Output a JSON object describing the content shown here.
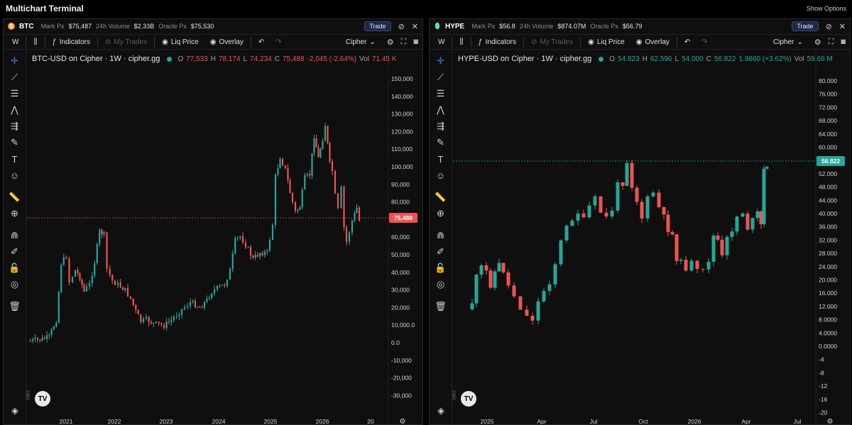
{
  "app": {
    "title": "Multichart Terminal",
    "show_options": "Show Options"
  },
  "left": {
    "symbol": "BTC",
    "info": {
      "mark_label": "Mark Px",
      "mark": "$75,487",
      "vol_label": "24h Volume",
      "vol": "$2.33B",
      "oracle_label": "Oracle Px",
      "oracle": "$75,530"
    },
    "trade": "Trade",
    "toolbar": {
      "interval": "W",
      "indicators": "Indicators",
      "my_trades": "My Trades",
      "liq_price": "Liq Price",
      "overlay": "Overlay",
      "source": "Cipher"
    },
    "legend": {
      "title": "BTC-USD on Cipher · 1W · cipher.gg",
      "o_k": "O",
      "o": "77,533",
      "h_k": "H",
      "h": "78,174",
      "l_k": "L",
      "l": "74,234",
      "c_k": "C",
      "c": "75,488",
      "chg": "-2,045 (-2.64%)",
      "vol_k": "Vol",
      "vol": "71.45 K"
    },
    "price_label": "75,488",
    "y_ticks": [
      "150,000",
      "140,000",
      "130,000",
      "120,000",
      "110,000",
      "100,000",
      "90,000",
      "80,000",
      "70,000",
      "60,000",
      "50,000",
      "40,000",
      "30,000",
      "20,000",
      "10,000.0",
      "0.0",
      "-10,000",
      "-20,000",
      "-30,000"
    ],
    "x_ticks": [
      "2021",
      "2022",
      "2023",
      "2024",
      "2025",
      "2026",
      "20"
    ],
    "colors": {
      "up": "#26a69a",
      "down": "#ef5350",
      "label": "#ef5350"
    }
  },
  "right": {
    "symbol": "HYPE",
    "info": {
      "mark_label": "Mark Px",
      "mark": "$56.8",
      "vol_label": "24h Volume",
      "vol": "$874.07M",
      "oracle_label": "Oracle Px",
      "oracle": "$56.79"
    },
    "trade": "Trade",
    "toolbar": {
      "interval": "W",
      "indicators": "Indicators",
      "my_trades": "My Trades",
      "liq_price": "Liq Price",
      "overlay": "Overlay",
      "source": "Cipher"
    },
    "legend": {
      "title": "HYPE-USD on Cipher · 1W · cipher.gg",
      "o_k": "O",
      "o": "54.823",
      "h_k": "H",
      "h": "62.596",
      "l_k": "L",
      "l": "54.000",
      "c_k": "C",
      "c": "56.822",
      "chg": "1.9860 (+3.62%)",
      "vol_k": "Vol",
      "vol": "59.66 M"
    },
    "price_label": "56.822",
    "y_ticks": [
      "80.000",
      "76.000",
      "72.000",
      "68.000",
      "64.000",
      "60.000",
      "56.000",
      "52.000",
      "48.000",
      "44.000",
      "40.000",
      "36.000",
      "32.000",
      "28.000",
      "24.000",
      "20.000",
      "16.000",
      "12.000",
      "8.0000",
      "4.0000",
      "0.0000",
      "-4",
      "-8",
      "-12",
      "-16",
      "-20"
    ],
    "x_ticks": [
      "2025",
      "Apr",
      "Jul",
      "Oct",
      "2026",
      "Apr",
      "Jul"
    ],
    "colors": {
      "up": "#26a69a",
      "down": "#ef5350",
      "label": "#26a69a"
    }
  },
  "icons": {
    "tools": [
      "crosshair-icon",
      "trend-line-icon",
      "fib-icon",
      "pattern-icon",
      "measure-lines-icon",
      "brush-icon",
      "text-icon",
      "emoji-icon",
      "ruler-icon",
      "zoom-icon",
      "magnet-icon",
      "lock-pencil-icon",
      "lock-icon",
      "eye-icon",
      "trash-icon"
    ]
  }
}
